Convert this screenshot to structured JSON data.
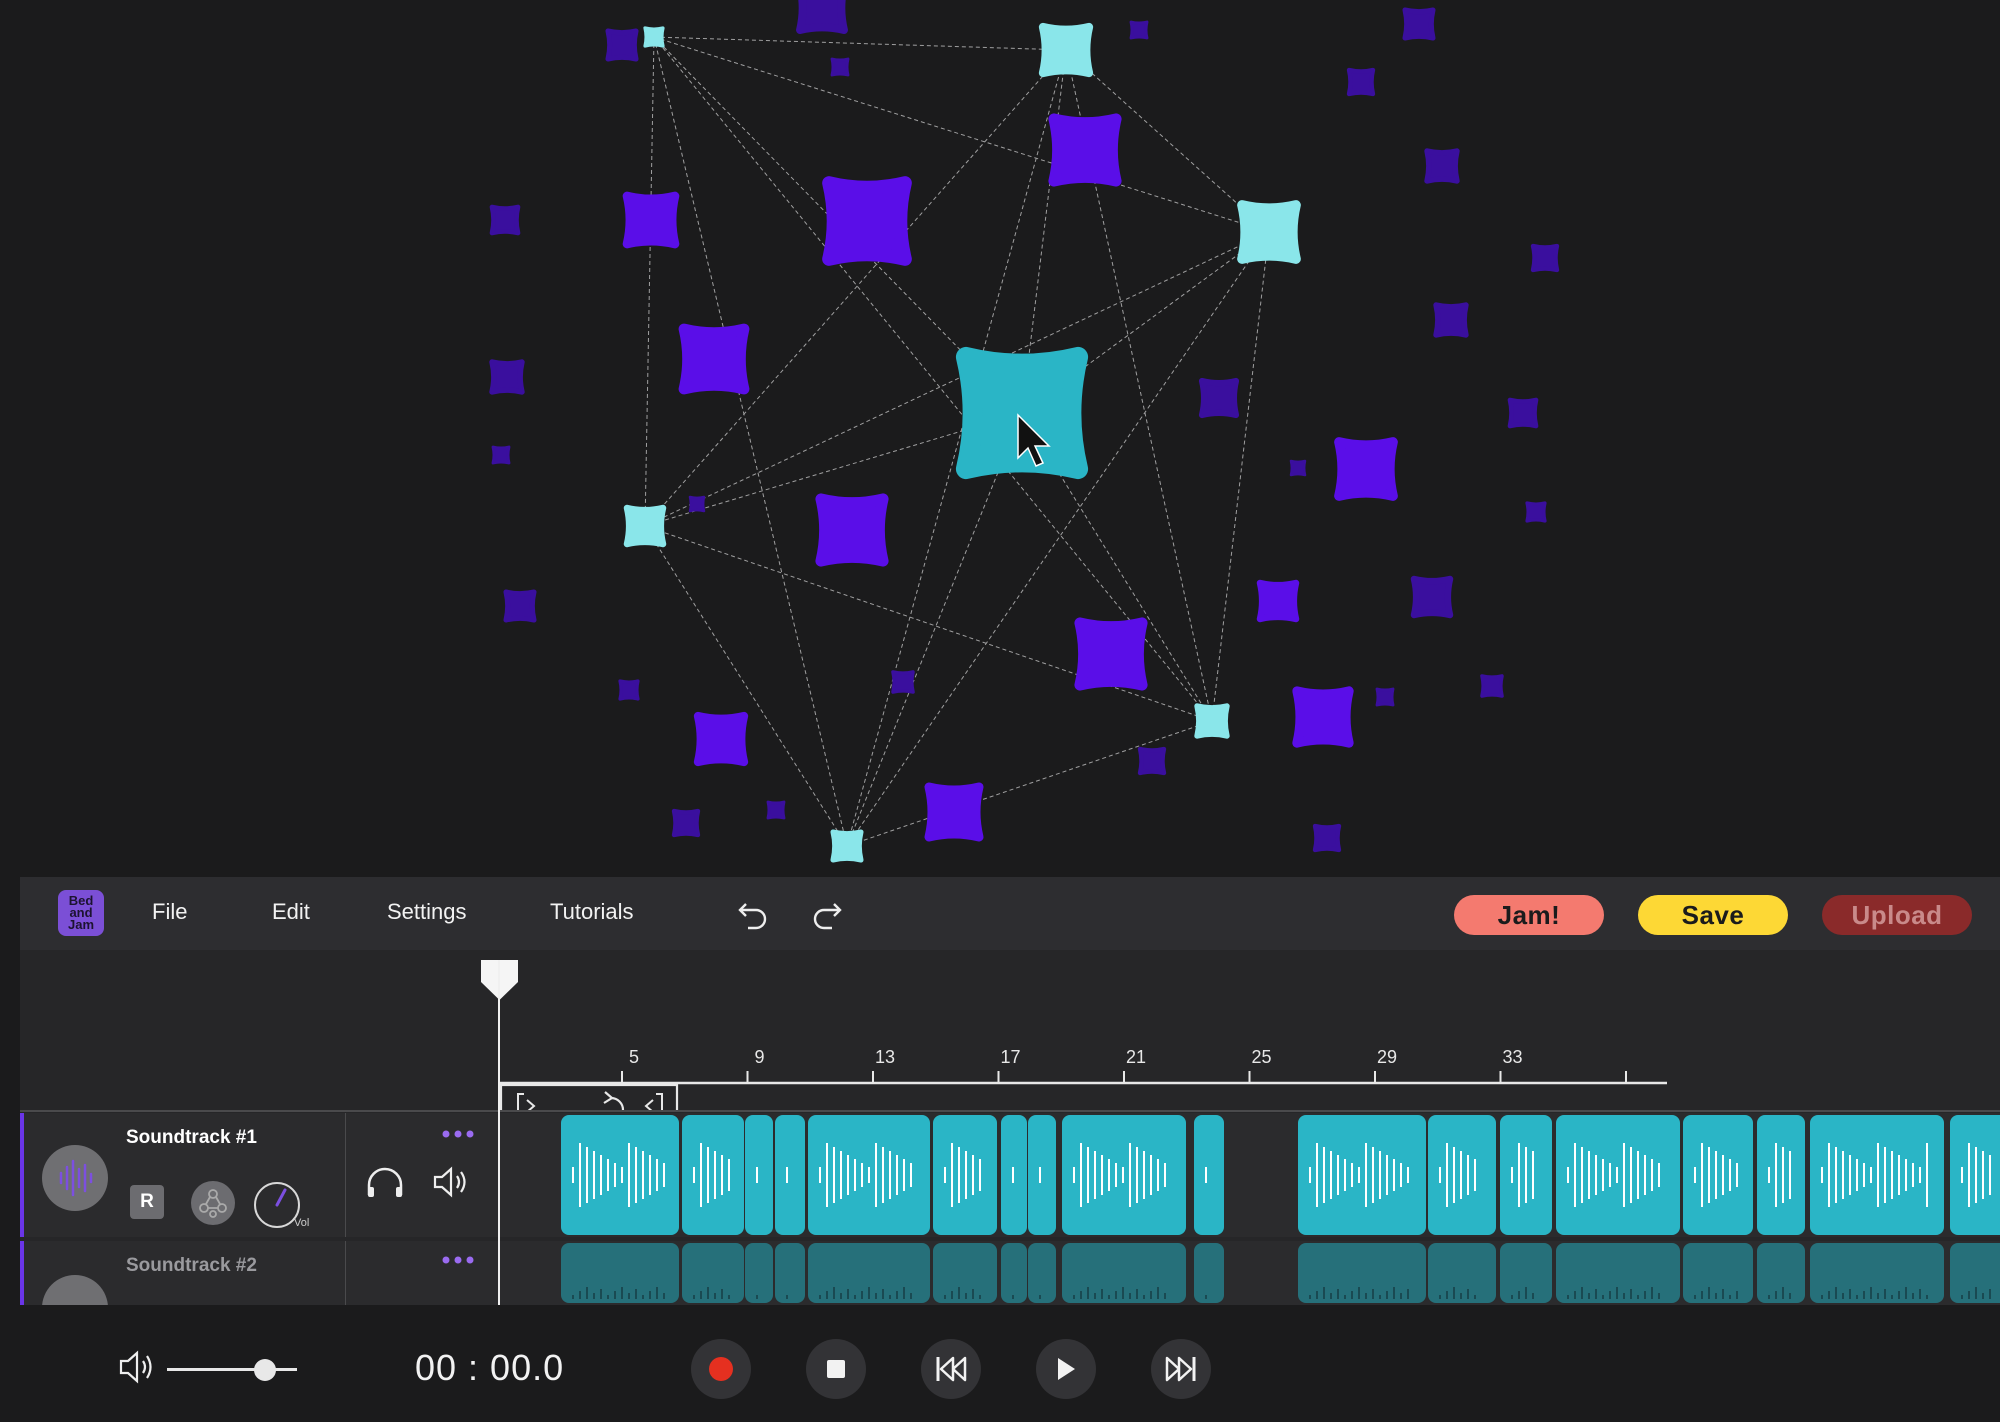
{
  "app": {
    "logo_text": "Bed and Jam",
    "menu": [
      "File",
      "Edit",
      "Settings",
      "Tutorials"
    ],
    "buttons": {
      "jam": "Jam!",
      "save": "Save",
      "upload": "Upload"
    }
  },
  "colors": {
    "background": "#1b1b1c",
    "panel": "#262628",
    "node_purple": "#5a0ee8",
    "node_dim_purple": "#3a0f9e",
    "node_cyan": "#8ae6ea",
    "node_teal": "#2ab5c6",
    "clip": "#2ab5c6",
    "jam": "#f47a6f",
    "save": "#fdd835",
    "upload": "#8a2a2a",
    "accent": "#6a35e8",
    "record": "#e53020"
  },
  "timeline": {
    "ruler_labels": [
      "5",
      "9",
      "13",
      "17",
      "21",
      "25",
      "29",
      "33"
    ]
  },
  "tracks": [
    {
      "name": "Soundtrack #1",
      "record_label": "R",
      "vol_label": "Vol"
    },
    {
      "name": "Soundtrack #2"
    }
  ],
  "transport": {
    "time": "00 : 00.0",
    "volume_level": 0.75
  },
  "icons": {
    "undo": "undo-icon",
    "redo": "redo-icon",
    "loop": "loop-icon",
    "headphones": "headphones-icon",
    "speaker": "speaker-icon",
    "record": "record-icon",
    "stop": "stop-icon",
    "rewind": "rewind-icon",
    "play": "play-icon",
    "fast_forward": "fast-forward-icon",
    "cursor": "cursor-icon"
  }
}
